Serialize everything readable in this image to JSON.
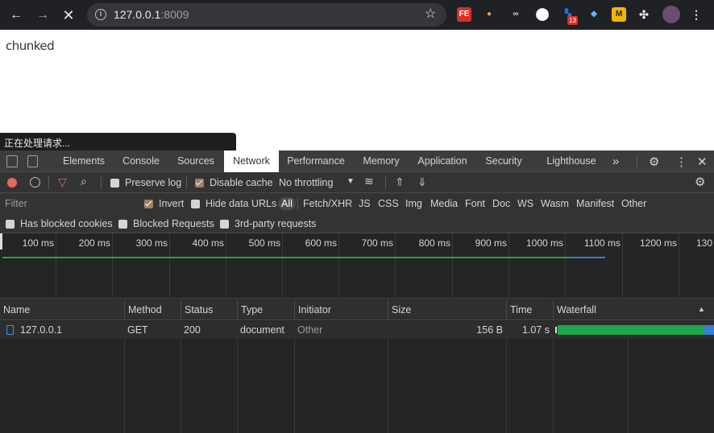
{
  "browser": {
    "url_host": "127.0.0.1",
    "url_port": ":8009",
    "extensions": [
      {
        "name": "fe-helper-icon",
        "label": "FE",
        "color": "#d93025"
      },
      {
        "name": "cookie-icon",
        "label": "🍪",
        "color": "#202124"
      },
      {
        "name": "glasses-icon",
        "label": "👓",
        "color": "#202124"
      },
      {
        "name": "circle-extension-icon",
        "label": "◯",
        "color": "#202124"
      },
      {
        "name": "dev-extension-icon",
        "label": "◆",
        "color": "#1a73e8"
      },
      {
        "name": "gem-icon",
        "label": "💎",
        "color": "#202124"
      },
      {
        "name": "m-extension-icon",
        "label": "M",
        "color": "#f4b400"
      },
      {
        "name": "puzzle-icon",
        "label": "🧩",
        "color": "#202124"
      }
    ],
    "badge_count": "13"
  },
  "page": {
    "body_text": "chunked",
    "status_text": "正在处理请求..."
  },
  "devtools": {
    "tabs": [
      "Elements",
      "Console",
      "Sources",
      "Network",
      "Performance",
      "Memory",
      "Application",
      "Security",
      "Lighthouse"
    ],
    "active_tab": "Network",
    "more_tabs": "»",
    "toolbar": {
      "preserve_log": "Preserve log",
      "disable_cache": "Disable cache",
      "throttling": "No throttling"
    },
    "filter": {
      "placeholder": "Filter",
      "invert": "Invert",
      "hide_data_urls": "Hide data URLs",
      "types": [
        "All",
        "Fetch/XHR",
        "JS",
        "CSS",
        "Img",
        "Media",
        "Font",
        "Doc",
        "WS",
        "Wasm",
        "Manifest",
        "Other"
      ],
      "has_blocked_cookies": "Has blocked cookies",
      "blocked_requests": "Blocked Requests",
      "third_party": "3rd-party requests"
    },
    "timeline_ticks": [
      "100 ms",
      "200 ms",
      "300 ms",
      "400 ms",
      "500 ms",
      "600 ms",
      "700 ms",
      "800 ms",
      "900 ms",
      "1000 ms",
      "1100 ms",
      "1200 ms",
      "130"
    ],
    "columns": [
      "Name",
      "Method",
      "Status",
      "Type",
      "Initiator",
      "Size",
      "Time",
      "Waterfall"
    ],
    "rows": [
      {
        "name": "127.0.0.1",
        "method": "GET",
        "status": "200",
        "type": "document",
        "initiator": "Other",
        "size": "156 B",
        "time": "1.07 s"
      }
    ]
  }
}
